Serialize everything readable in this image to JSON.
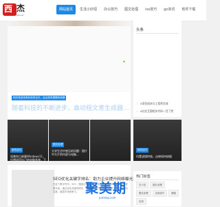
{
  "logo": {
    "mark": "西",
    "mark2": "杰",
    "sub": "XiJie.net"
  },
  "nav": {
    "items": [
      {
        "label": "网站首页",
        "active": true
      },
      {
        "label": "生活小妙招",
        "active": false
      },
      {
        "label": "办公技巧",
        "active": false
      },
      {
        "label": "图文处理",
        "active": false
      },
      {
        "label": "ios技巧",
        "active": false
      },
      {
        "label": "go资讯",
        "active": false
      },
      {
        "label": "软件下载",
        "active": false
      }
    ]
  },
  "feature": {
    "badge": "明天将迎来奇妙雨夹空天，会出现风雪飘风雨情",
    "title": "随着科技的不断进步，曲动程文意生成器..."
  },
  "cards": [
    {
      "tag": "软件技巧",
      "title": "如果你已卸载Windows11，但想退回自己的电脑系统，下面的方法可以..."
    },
    {
      "tag": "图文处理",
      "title": "大学生活中常见的问题：图片中大片的内容与电脑..."
    },
    {
      "tag": "软件技巧",
      "title": ""
    },
    {
      "tag": "软件技巧",
      "title": "内置滤镜特效，自带如何修图"
    }
  ],
  "sidebar": {
    "news_title": "头条",
    "news_items": [
      "A项目成本与工程师交流",
      "A社交互图相关代码一目了然"
    ],
    "tags_title": "热门标签",
    "tags": [
      "无人机",
      "图片处理",
      "图文处理",
      "实用技巧",
      "美图",
      "实用"
    ]
  },
  "lower": {
    "title": "SEO优化关键字排名：助力企业提升网络曝光率",
    "text": "在这个数字时代，SEO（搜索引擎优化）已成为企业提升网络曝光率的重要手段。通过优化关键词排名，企业可以吸引更多潜在客户，提升品牌知名度，增强市场竞争力。"
  },
  "watermark": {
    "text": "聚美期",
    "url": "jumeiqi.com"
  }
}
